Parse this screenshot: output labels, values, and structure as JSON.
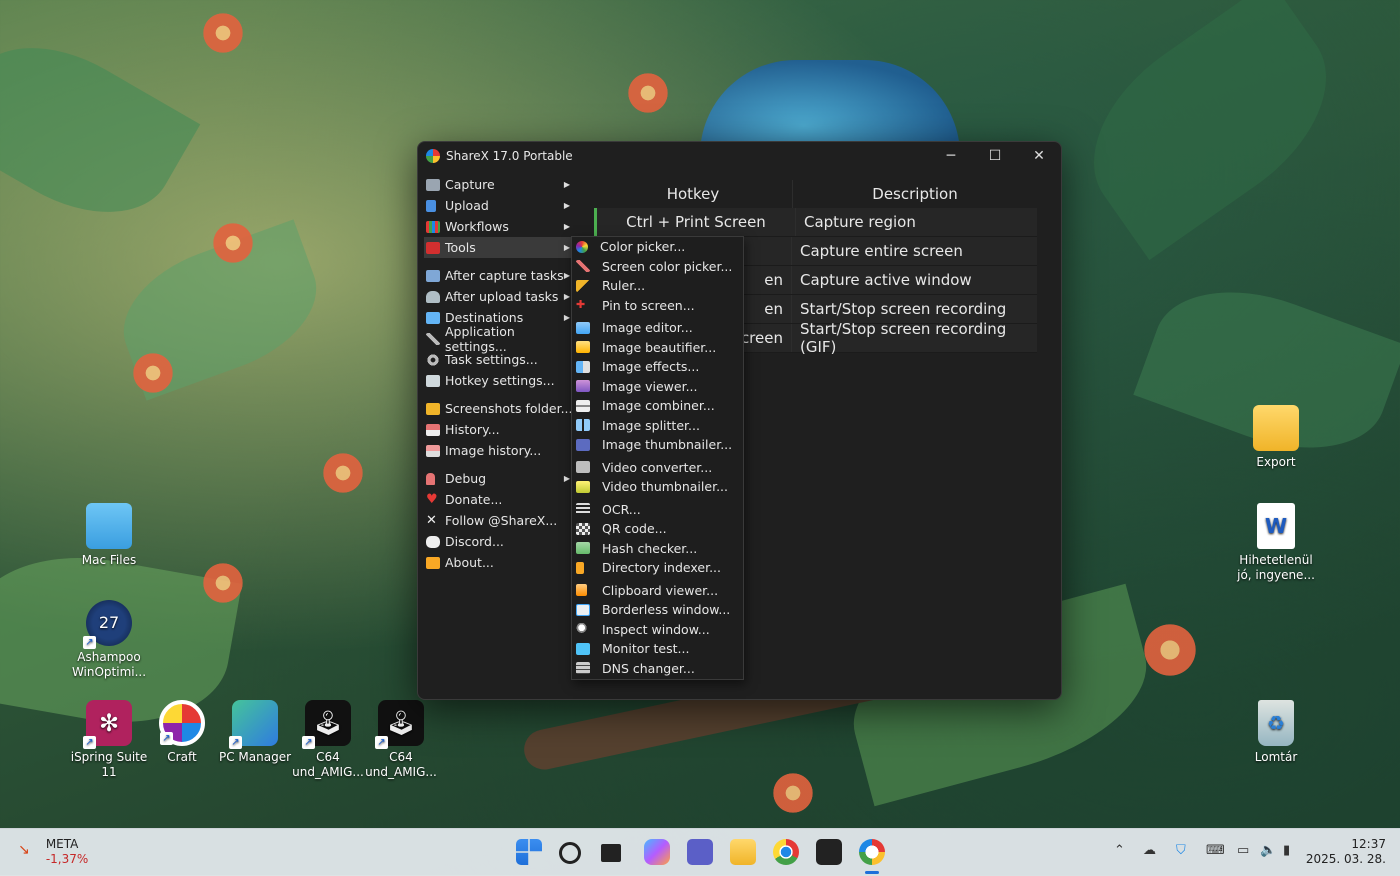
{
  "window": {
    "title": "ShareX 17.0 Portable",
    "controls": {
      "minimize": "─",
      "maximize": "☐",
      "close": "✕"
    }
  },
  "left_menu": [
    {
      "label": "Capture",
      "icon": "capture-icon",
      "submenu": true
    },
    {
      "label": "Upload",
      "icon": "upload-icon",
      "submenu": true
    },
    {
      "label": "Workflows",
      "icon": "workflows-icon",
      "submenu": true
    },
    {
      "label": "Tools",
      "icon": "tools-icon",
      "submenu": true,
      "active": true
    },
    {
      "label": "After capture tasks",
      "icon": "after-capture-icon",
      "submenu": true
    },
    {
      "label": "After upload tasks",
      "icon": "after-upload-icon",
      "submenu": true
    },
    {
      "label": "Destinations",
      "icon": "destinations-icon",
      "submenu": true
    },
    {
      "label": "Application settings...",
      "icon": "app-settings-icon"
    },
    {
      "label": "Task settings...",
      "icon": "gear-icon"
    },
    {
      "label": "Hotkey settings...",
      "icon": "keyboard-icon"
    },
    {
      "label": "Screenshots folder...",
      "icon": "folder-icon"
    },
    {
      "label": "History...",
      "icon": "history-icon"
    },
    {
      "label": "Image history...",
      "icon": "image-history-icon"
    },
    {
      "label": "Debug",
      "icon": "debug-icon",
      "submenu": true
    },
    {
      "label": "Donate...",
      "icon": "heart-icon"
    },
    {
      "label": "Follow @ShareX...",
      "icon": "x-logo-icon"
    },
    {
      "label": "Discord...",
      "icon": "discord-icon"
    },
    {
      "label": "About...",
      "icon": "crown-icon"
    }
  ],
  "hotkeys": {
    "headers": [
      "Hotkey",
      "Description"
    ],
    "rows": [
      {
        "hotkey": "Ctrl + Print Screen",
        "description": "Capture region"
      },
      {
        "hotkey": "",
        "description": "Capture entire screen"
      },
      {
        "hotkey": "en",
        "description": "Capture active window"
      },
      {
        "hotkey": "en",
        "description": "Start/Stop screen recording"
      },
      {
        "hotkey": "creen",
        "description": "Start/Stop screen recording (GIF)"
      }
    ]
  },
  "tools_submenu": [
    {
      "label": "Color picker...",
      "icon": "color-picker-icon"
    },
    {
      "label": "Screen color picker...",
      "icon": "eyedropper-icon"
    },
    {
      "label": "Ruler...",
      "icon": "ruler-icon"
    },
    {
      "label": "Pin to screen...",
      "icon": "pin-icon"
    },
    {
      "label": "Image editor...",
      "icon": "image-editor-icon"
    },
    {
      "label": "Image beautifier...",
      "icon": "image-beautifier-icon"
    },
    {
      "label": "Image effects...",
      "icon": "image-effects-icon"
    },
    {
      "label": "Image viewer...",
      "icon": "image-viewer-icon"
    },
    {
      "label": "Image combiner...",
      "icon": "image-combiner-icon"
    },
    {
      "label": "Image splitter...",
      "icon": "image-splitter-icon"
    },
    {
      "label": "Image thumbnailer...",
      "icon": "image-thumbnailer-icon"
    },
    {
      "label": "Video converter...",
      "icon": "video-converter-icon"
    },
    {
      "label": "Video thumbnailer...",
      "icon": "video-thumbnailer-icon"
    },
    {
      "label": "OCR...",
      "icon": "ocr-icon"
    },
    {
      "label": "QR code...",
      "icon": "qr-code-icon"
    },
    {
      "label": "Hash checker...",
      "icon": "hash-icon"
    },
    {
      "label": "Directory indexer...",
      "icon": "directory-icon"
    },
    {
      "label": "Clipboard viewer...",
      "icon": "clipboard-icon"
    },
    {
      "label": "Borderless window...",
      "icon": "borderless-window-icon"
    },
    {
      "label": "Inspect window...",
      "icon": "inspect-icon"
    },
    {
      "label": "Monitor test...",
      "icon": "monitor-icon"
    },
    {
      "label": "DNS changer...",
      "icon": "dns-icon"
    }
  ],
  "desktop_icons": [
    {
      "label": "Mac Files",
      "icon": "folder-icon"
    },
    {
      "label": "Ashampoo WinOptimi...",
      "icon": "ashampoo-icon"
    },
    {
      "label": "iSpring Suite 11",
      "icon": "ispring-icon"
    },
    {
      "label": "Craft",
      "icon": "craft-icon"
    },
    {
      "label": "PC Manager",
      "icon": "pc-manager-icon"
    },
    {
      "label": "C64 und_AMIG...",
      "icon": "joystick-icon"
    },
    {
      "label": "C64 und_AMIG...",
      "icon": "joystick-icon"
    },
    {
      "label": "Export",
      "icon": "folder-icon"
    },
    {
      "label": "Hihetetlenül jó, ingyene...",
      "icon": "word-icon"
    },
    {
      "label": "Lomtár",
      "icon": "recycle-bin-icon"
    }
  ],
  "taskbar": {
    "stock": {
      "ticker": "META",
      "change": "-1,37%"
    },
    "apps": [
      "start-icon",
      "search-icon",
      "task-view-icon",
      "copilot-icon",
      "teams-icon",
      "file-explorer-icon",
      "chrome-icon",
      "app-icon",
      "sharex-icon"
    ],
    "clock": {
      "time": "12:37",
      "date": "2025. 03. 28."
    },
    "colors": {
      "start": "#1e6fd9",
      "accent_red": "#c62828"
    }
  }
}
